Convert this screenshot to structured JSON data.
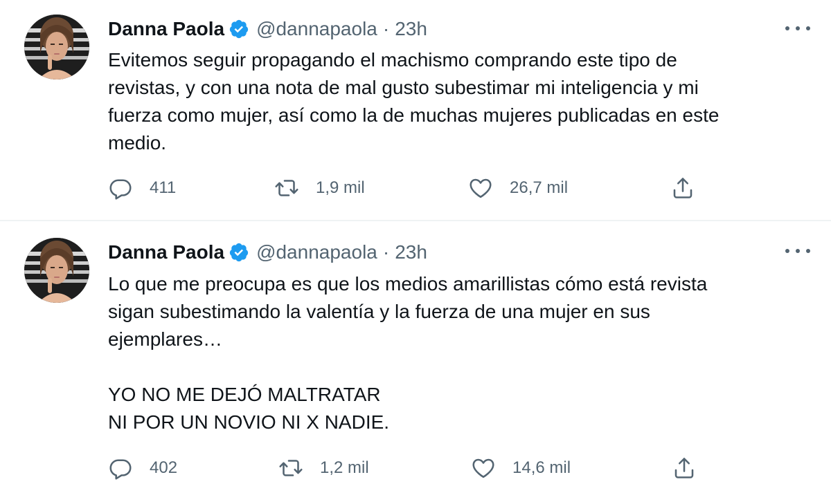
{
  "tweets": [
    {
      "author": {
        "name": "Danna Paola",
        "handle": "@dannapaola",
        "verified": true
      },
      "separator": "·",
      "time": "23h",
      "text": "Evitemos seguir propagando el machismo comprando este tipo de\nrevistas, y con una nota de mal gusto subestimar mi inteligencia y mi\nfuerza como mujer, así como la de muchas mujeres publicadas en este\nmedio.",
      "counts": {
        "replies": "411",
        "retweets": "1,9 mil",
        "likes": "26,7 mil"
      }
    },
    {
      "author": {
        "name": "Danna Paola",
        "handle": "@dannapaola",
        "verified": true
      },
      "separator": "·",
      "time": "23h",
      "text": "Lo que me preocupa es que los medios amarillistas cómo está revista\nsigan subestimando la valentía y la fuerza de una mujer en sus\nejemplares…\n\nYO NO ME DEJÓ MALTRATAR\nNI POR UN NOVIO NI X NADIE.",
      "counts": {
        "replies": "402",
        "retweets": "1,2 mil",
        "likes": "14,6 mil"
      }
    }
  ],
  "icons": {
    "verified": "verified-badge-icon",
    "more": "more-dots-icon",
    "reply": "reply-icon",
    "retweet": "retweet-icon",
    "like": "heart-icon",
    "share": "share-icon"
  },
  "colors": {
    "verified_blue": "#1d9bf0",
    "text_primary": "#0f1419",
    "text_secondary": "#536471",
    "divider": "#eff3f4"
  }
}
